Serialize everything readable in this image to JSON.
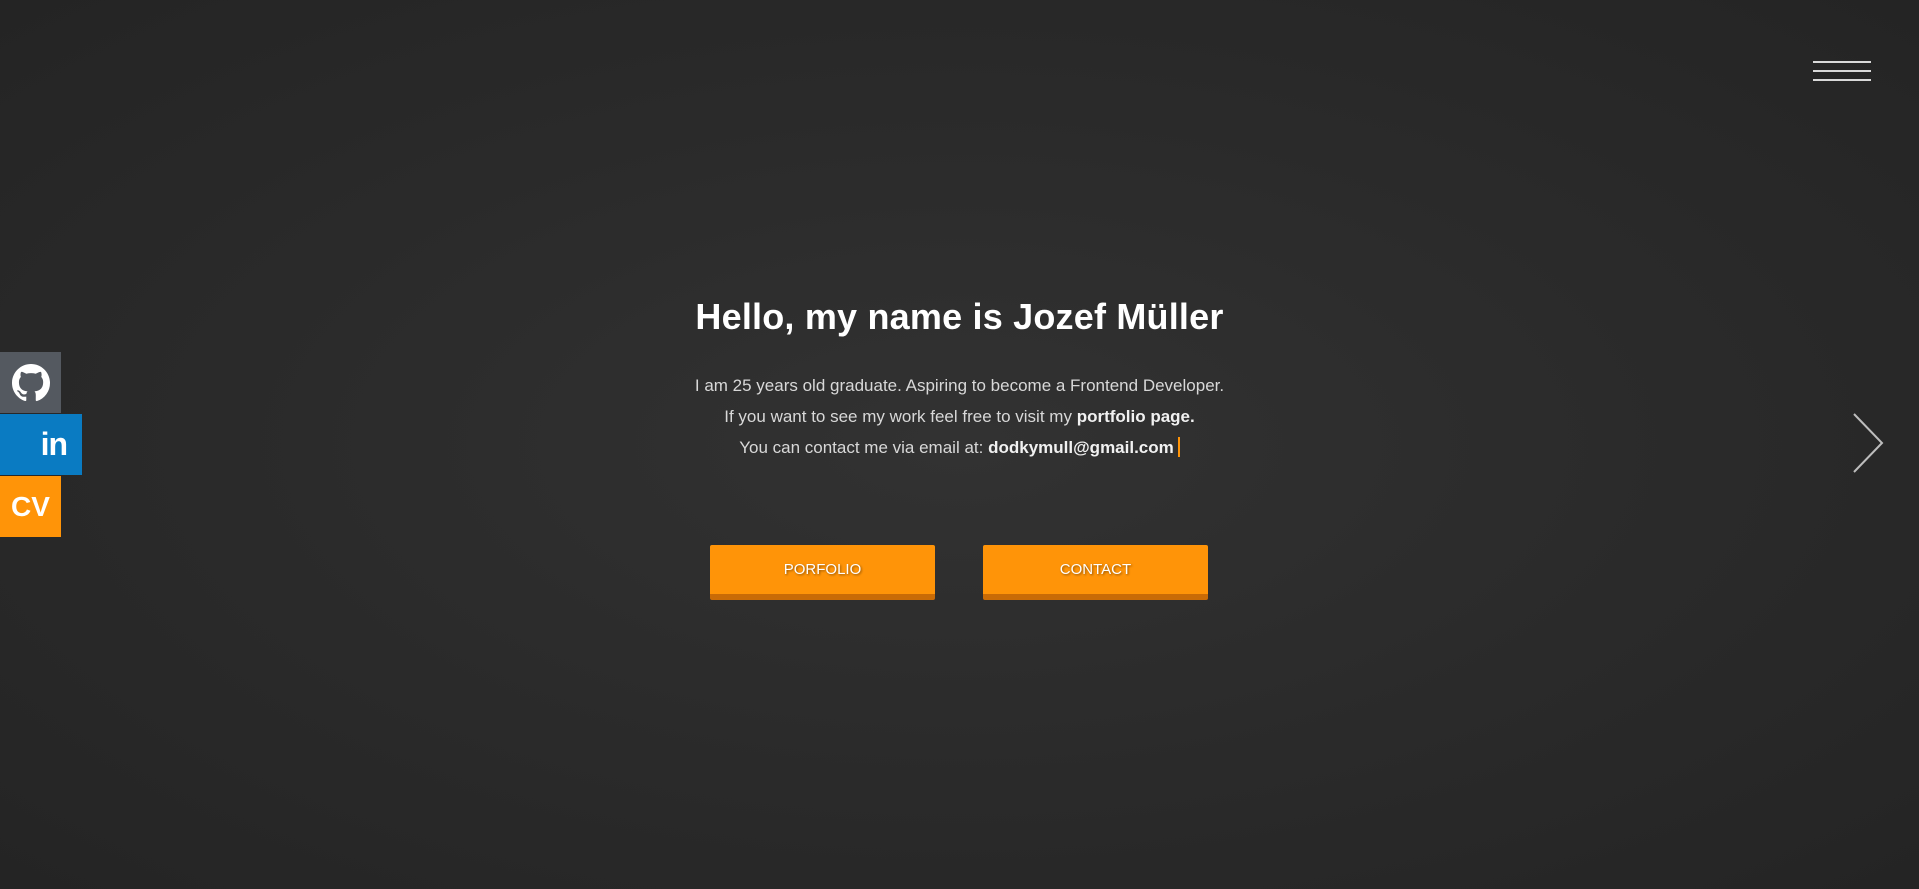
{
  "header": {
    "menu_icon": "hamburger-menu-icon"
  },
  "social": {
    "github_icon": "github-icon",
    "linkedin_label": "in",
    "cv_label": "CV",
    "colors": {
      "github": "#545960",
      "linkedin": "#0a7bc2",
      "cv": "#ff9408"
    }
  },
  "hero": {
    "title": "Hello, my name is Jozef Müller",
    "line1": "I am 25 years old graduate. Aspiring to become a Frontend Developer.",
    "line2_prefix": "If you want to see my work feel free to visit my",
    "line2_link": "portfolio page.",
    "line3_prefix": "You can contact me via email at:",
    "line3_email": "dodkymull@gmail.com"
  },
  "buttons": {
    "portfolio_label": "PORFOLIO",
    "contact_label": "CONTACT"
  },
  "nav": {
    "next_icon": "chevron-right-icon"
  },
  "theme": {
    "accent": "#ff9408",
    "background": "#2b2b2b"
  }
}
